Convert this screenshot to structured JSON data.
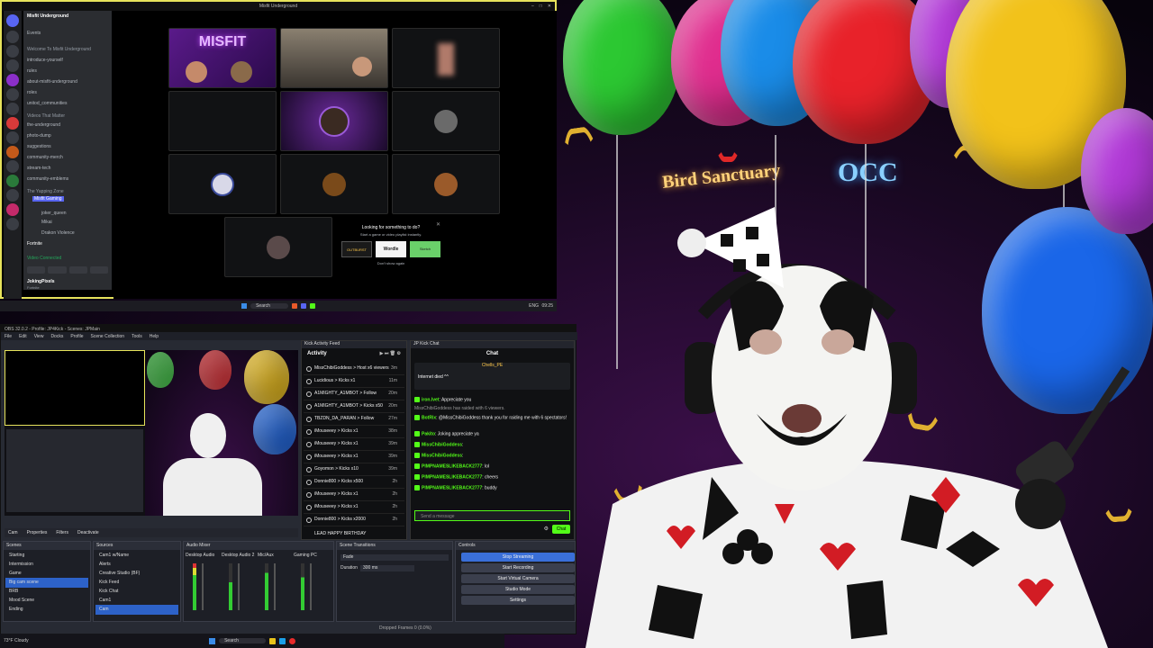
{
  "discord": {
    "title": "Misfit Underground",
    "server_name": "Misfit Underground",
    "events": "Events",
    "channels": [
      {
        "label": "Welcome To Misfit Underground",
        "category": true
      },
      {
        "label": "introduce-yourself"
      },
      {
        "label": "rules"
      },
      {
        "label": "about-misfit-underground"
      },
      {
        "label": "roles"
      },
      {
        "label": "unitod_communities"
      },
      {
        "label": "Videos That Matter",
        "category": true
      },
      {
        "label": "the-underground"
      },
      {
        "label": "photo-dump"
      },
      {
        "label": "suggestions"
      },
      {
        "label": "community-merch"
      },
      {
        "label": "stream-tech"
      },
      {
        "label": "community-emblems"
      },
      {
        "label": "The Yapping Zone",
        "category": true
      }
    ],
    "voice_users": [
      "Misfit Gaming",
      "joker_queen",
      "Mikai",
      "Drakon Violence"
    ],
    "game_label": "Fortnite",
    "voice_status": "Video Connected",
    "user_name": "JokingPixels",
    "user_status": "Fortnite",
    "tiles": [
      {
        "type": "banner",
        "text": "MISFIT"
      },
      {
        "type": "webcam",
        "text": ""
      },
      {
        "type": "blur",
        "text": ""
      },
      {
        "type": "empty",
        "text": ""
      },
      {
        "type": "webcam-center",
        "text": ""
      },
      {
        "type": "avatar",
        "text": ""
      },
      {
        "type": "avatar",
        "text": ""
      },
      {
        "type": "avatar",
        "text": ""
      },
      {
        "type": "avatar",
        "text": ""
      },
      {
        "type": "avatar",
        "text": ""
      }
    ],
    "activity_prompt": "Looking for something to do?",
    "activity_sub": "Start a game or video playlist instantly.",
    "activity_games": [
      "OUTBURST",
      "Wordle",
      "Sketch"
    ],
    "dont_show_again": "Don't show again"
  },
  "taskbar_top": {
    "search": "Search",
    "clock": "09:25",
    "lang": "ENG"
  },
  "obs": {
    "title": "OBS 32.0.2 - Profile: JP4Kick - Scenes: JPMain",
    "menu": [
      "File",
      "Edit",
      "View",
      "Docks",
      "Profile",
      "Scene Collection",
      "Tools",
      "Help"
    ],
    "source_bar": [
      "Cam",
      "Properties",
      "Filters",
      "Deactivate"
    ],
    "scenes_title": "Scenes",
    "scenes": [
      "Starting",
      "Intermission",
      "Game",
      "Big cam scene",
      "BRB",
      "Mood Scene",
      "Ending"
    ],
    "sources_title": "Sources",
    "sources": [
      "Cam1 w/Name",
      "Alerts",
      "Creative Studio (BF)",
      "Kick Feed",
      "Kick Chat",
      "Cam1",
      "Cam"
    ],
    "mixer_title": "Audio Mixer",
    "mixer": [
      "Desktop Audio",
      "Desktop Audio 2",
      "Mic/Aux",
      "Gaming PC"
    ],
    "transitions_title": "Scene Transitions",
    "transition": "Fade",
    "duration_label": "Duration",
    "duration": "300 ms",
    "controls_title": "Controls",
    "controls": [
      "Stop Streaming",
      "Start Recording",
      "Start Virtual Camera",
      "Studio Mode",
      "Settings"
    ],
    "status": "Dropped Frames 0 (0.0%)"
  },
  "feed": {
    "title": "Kick Activity Feed",
    "header": "Activity",
    "items": [
      {
        "text": "MissChibiGoddess > Host x6 viewers",
        "time": "3m"
      },
      {
        "text": "Lucidious > Kicks x1",
        "time": "11m"
      },
      {
        "text": "A1MIGHTY_A1MBOT > Follow",
        "time": "20m"
      },
      {
        "text": "A1MIGHTY_A1MBOT > Kicks x50",
        "time": "20m"
      },
      {
        "text": "TBZDN_DA_PARAN > Follow",
        "time": "27m"
      },
      {
        "text": "iMouseeey > Kicks x1",
        "time": "38m"
      },
      {
        "text": "iMouseeey > Kicks x1",
        "time": "39m"
      },
      {
        "text": "iMouseeey > Kicks x1",
        "time": "39m"
      },
      {
        "text": "Goyomon > Kicks x10",
        "time": "39m"
      },
      {
        "text": "Donnie800 > Kicks x500",
        "time": "2h"
      },
      {
        "text": "iMouseeey > Kicks x1",
        "time": "2h"
      },
      {
        "text": "iMouseeey > Kicks x1",
        "time": "2h"
      },
      {
        "text": "Donnie800 > Kicks x2000",
        "time": "2h"
      }
    ],
    "footer": "LEAD HAPPY BIRTHDAY"
  },
  "chat": {
    "title": "JP Kick Chat",
    "header": "Chat",
    "pinned_user": "Chells_PE",
    "pinned_note": "Internet died ^^",
    "messages": [
      {
        "user": "iron.lvet",
        "text": "Appreciate you"
      },
      {
        "user": "",
        "text": "MissChibiGoddess has raided with 6 viewers."
      },
      {
        "user": "BotRix",
        "text": "@MissChibiGoddess thank you for raiding me with 6 spectators!"
      },
      {
        "user": "Pakito",
        "text": "Joking appreciate ya"
      },
      {
        "user": "MissChibiGoddess",
        "text": ""
      },
      {
        "user": "MissChibiGoddess",
        "text": ""
      },
      {
        "user": "PIMPNAMESLIKEBACK2777",
        "text": "lol"
      },
      {
        "user": "PIMPNAMESLIKEBACK2777",
        "text": "cheers"
      },
      {
        "user": "PIMPNAMESLIKEBACK2777",
        "text": "buddy"
      }
    ],
    "input_placeholder": "Send a message",
    "send_label": "Chat"
  },
  "taskbar_bottom": {
    "search": "Search",
    "weather": "73°F Cloudy"
  },
  "backdrop": {
    "neon_left": "Bird Sanctuary",
    "neon_right": "OCC",
    "colors": {
      "balloon_red": "#e8222a",
      "balloon_blue": "#1a66e8",
      "balloon_green": "#2cc832",
      "balloon_yellow": "#f2c21a",
      "balloon_purple": "#b23ad8"
    }
  }
}
